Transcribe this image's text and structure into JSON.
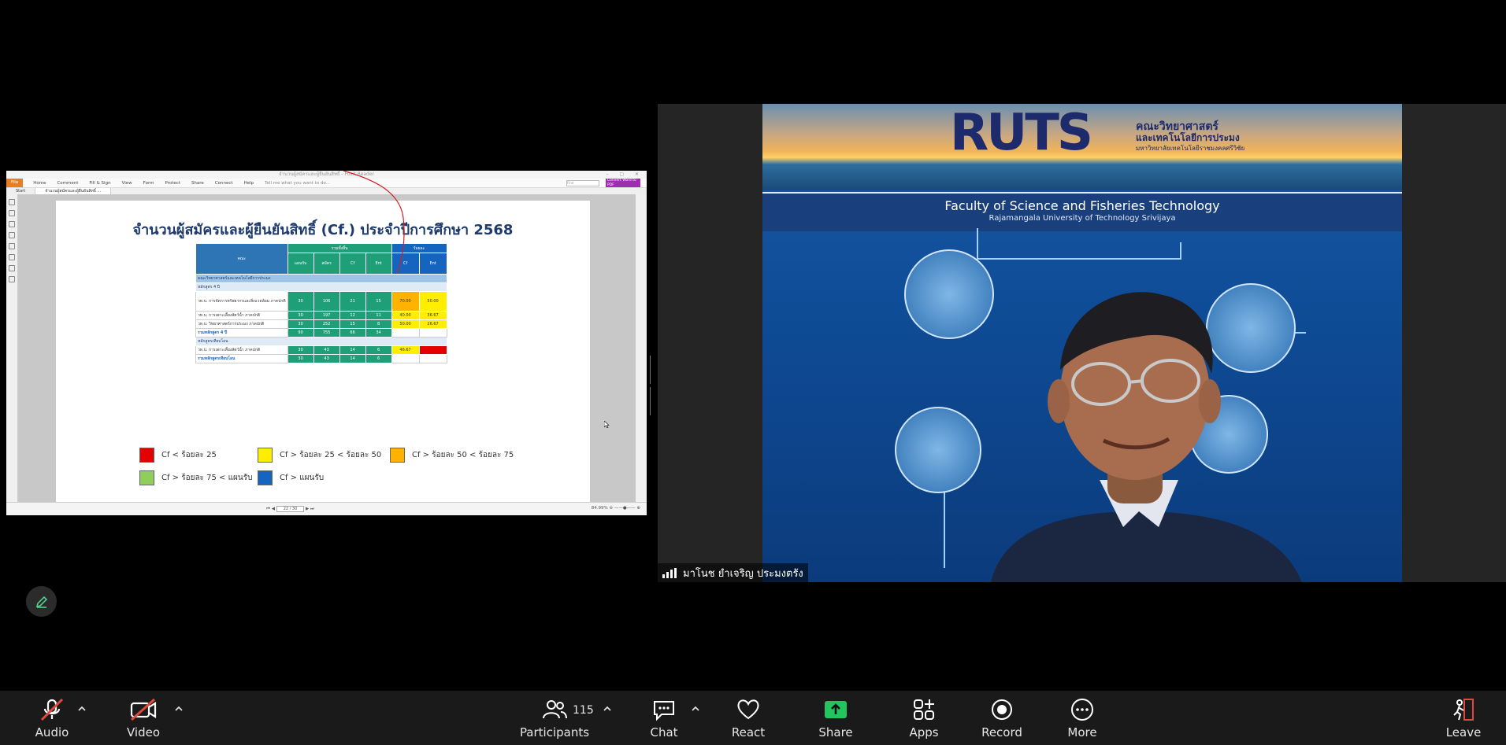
{
  "share": {
    "pdf_window_title": "จำนวนผู้สมัครและผู้ยืนยันสิทธิ์ - Foxit Reader",
    "ribbon": {
      "file": "File",
      "menus": [
        "Home",
        "Comment",
        "Fill & Sign",
        "View",
        "Form",
        "Protect",
        "Share",
        "Connect",
        "Help"
      ],
      "tell_me": "Tell me what you want to do...",
      "find": "Find",
      "convert": "Convert Word to PDF"
    },
    "tabs": [
      "Start",
      "จำนวนผู้สมัครและผู้ยืนยันสิทธิ์ ..."
    ],
    "status": {
      "page": "22 / 30",
      "zoom": "84.99%"
    },
    "document": {
      "title": "จำนวนผู้สมัครและผู้ยืนยันสิทธิ์ (Cf.) ประจำปีการศึกษา 2568",
      "table": {
        "faculty_header": "คณะ",
        "group_total": "รวมทั้งสิ้น",
        "group_percent": "ร้อยละ",
        "sub_headers": [
          "แผนรับ",
          "สมัคร",
          "Cf",
          "Ent",
          "Cf",
          "Ent"
        ],
        "faculty_row": "คณะวิทยาศาสตร์และเทคโนโลยีการประมง",
        "group_4yr": "หลักสูตร 4 ปี",
        "rows_4yr": [
          {
            "name": "วท.บ. การจัดการทรัพยากรและสิ่งแวดล้อม ภาคปกติ",
            "values": [
              "30",
              "106",
              "21",
              "15",
              "70.00",
              "50.00"
            ],
            "colors": [
              "org",
              "yel"
            ]
          },
          {
            "name": "วท.บ. การเพาะเลี้ยงสัตว์น้ำ ภาคปกติ",
            "values": [
              "30",
              "197",
              "12",
              "11",
              "40.00",
              "36.67"
            ],
            "colors": [
              "yel",
              "yel"
            ]
          },
          {
            "name": "วท.บ. วิทยาศาสตร์การประมง ภาคปกติ",
            "values": [
              "30",
              "252",
              "15",
              "8",
              "50.00",
              "26.67"
            ],
            "colors": [
              "yel",
              "yel"
            ]
          }
        ],
        "sum_4yr": {
          "name": "รวมหลักสูตร 4 ปี",
          "values": [
            "90",
            "755",
            "66",
            "34"
          ]
        },
        "group_transfer": "หลักสูตรเทียบโอน",
        "rows_transfer": [
          {
            "name": "วท.บ. การเพาะเลี้ยงสัตว์น้ำ ภาคปกติ",
            "values": [
              "30",
              "43",
              "14",
              "6",
              "46.67",
              ""
            ],
            "colors": [
              "yel",
              "red"
            ]
          }
        ],
        "sum_transfer": {
          "name": "รวมหลักสูตรเทียบโอน",
          "values": [
            "30",
            "43",
            "14",
            "6"
          ]
        }
      },
      "legend": [
        {
          "label": "Cf < ร้อยละ 25",
          "color": "#e50000"
        },
        {
          "label": "Cf > ร้อยละ 25 < ร้อยละ 50",
          "color": "#ffee00"
        },
        {
          "label": "Cf > ร้อยละ 50 < ร้อยละ 75",
          "color": "#ffb300"
        },
        {
          "label": "Cf > ร้อยละ 75 < แผนรับ",
          "color": "#8fce5a"
        },
        {
          "label": "Cf > แผนรับ",
          "color": "#1565c0"
        }
      ]
    }
  },
  "video": {
    "background": {
      "logo": "RUTS",
      "thai_line1": "คณะวิทยาศาสตร์",
      "thai_line2": "และเทคโนโลยีการประมง",
      "thai_line3": "มหาวิทยาลัยเทคโนโลยีราชมงคลศรีวิชัย",
      "english_line1": "Faculty of Science and Fisheries Technology",
      "english_line2": "Rajamangala University of Technology Srivijaya"
    },
    "participant_name": "มาโนช ยำเจริญ ประมงตรัง"
  },
  "toolbar": {
    "audio": "Audio",
    "video": "Video",
    "participants": "Participants",
    "participants_count": "115",
    "chat": "Chat",
    "react": "React",
    "share": "Share",
    "apps": "Apps",
    "record": "Record",
    "more": "More",
    "leave": "Leave"
  },
  "colors": {
    "share_green": "#22c55e",
    "muted_red": "#e0493e",
    "toolbar_bg": "#1a1a1a"
  }
}
